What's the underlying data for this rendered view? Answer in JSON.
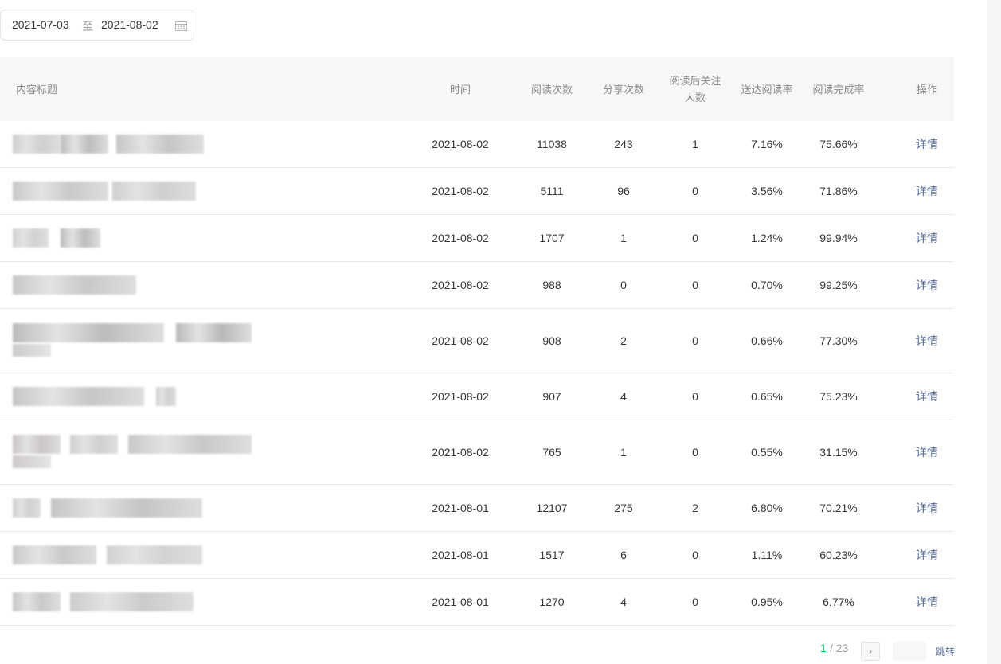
{
  "date_range": {
    "start": "2021-07-03",
    "separator": "至",
    "end": "2021-08-02"
  },
  "table": {
    "headers": {
      "title": "内容标题",
      "time": "时间",
      "reads": "阅读次数",
      "shares": "分享次数",
      "follow_line1": "阅读后关注",
      "follow_line2": "人数",
      "delivery_rate": "送达阅读率",
      "completion_rate": "阅读完成率",
      "action": "操作"
    },
    "rows": [
      {
        "time": "2021-08-02",
        "reads": "11038",
        "shares": "243",
        "follows": "1",
        "delivery_rate": "7.16%",
        "completion_rate": "75.66%",
        "action": "详情"
      },
      {
        "time": "2021-08-02",
        "reads": "5111",
        "shares": "96",
        "follows": "0",
        "delivery_rate": "3.56%",
        "completion_rate": "71.86%",
        "action": "详情"
      },
      {
        "time": "2021-08-02",
        "reads": "1707",
        "shares": "1",
        "follows": "0",
        "delivery_rate": "1.24%",
        "completion_rate": "99.94%",
        "action": "详情"
      },
      {
        "time": "2021-08-02",
        "reads": "988",
        "shares": "0",
        "follows": "0",
        "delivery_rate": "0.70%",
        "completion_rate": "99.25%",
        "action": "详情"
      },
      {
        "time": "2021-08-02",
        "reads": "908",
        "shares": "2",
        "follows": "0",
        "delivery_rate": "0.66%",
        "completion_rate": "77.30%",
        "action": "详情"
      },
      {
        "time": "2021-08-02",
        "reads": "907",
        "shares": "4",
        "follows": "0",
        "delivery_rate": "0.65%",
        "completion_rate": "75.23%",
        "action": "详情"
      },
      {
        "time": "2021-08-02",
        "reads": "765",
        "shares": "1",
        "follows": "0",
        "delivery_rate": "0.55%",
        "completion_rate": "31.15%",
        "action": "详情"
      },
      {
        "time": "2021-08-01",
        "reads": "12107",
        "shares": "275",
        "follows": "2",
        "delivery_rate": "6.80%",
        "completion_rate": "70.21%",
        "action": "详情"
      },
      {
        "time": "2021-08-01",
        "reads": "1517",
        "shares": "6",
        "follows": "0",
        "delivery_rate": "1.11%",
        "completion_rate": "60.23%",
        "action": "详情"
      },
      {
        "time": "2021-08-01",
        "reads": "1270",
        "shares": "4",
        "follows": "0",
        "delivery_rate": "0.95%",
        "completion_rate": "6.77%",
        "action": "详情"
      }
    ]
  },
  "pagination": {
    "current": "1",
    "total": "/ 23",
    "jump_label": "跳转"
  },
  "icons": {
    "date": "calendar-icon",
    "next": "chevron-right-icon"
  },
  "colors": {
    "link": "#576b95",
    "active_page": "#07c160",
    "header_bg": "#f6f7f8"
  }
}
